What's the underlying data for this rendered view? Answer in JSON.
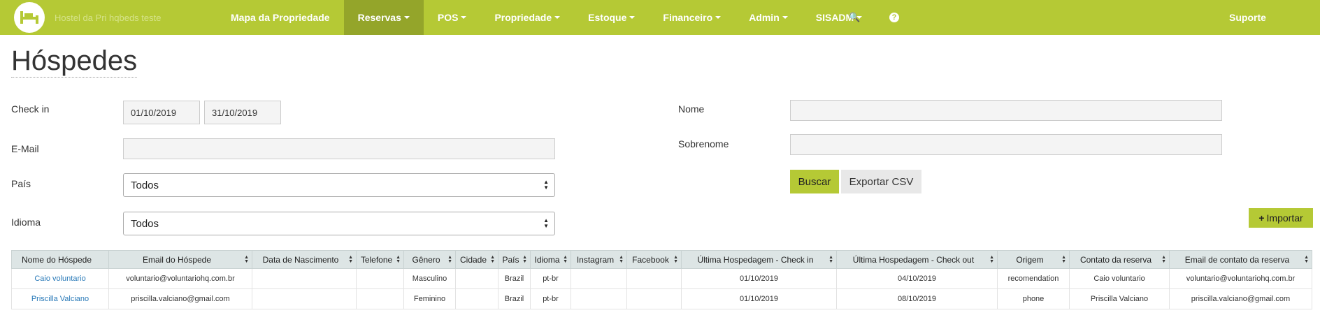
{
  "navbar": {
    "brand": "Hostel da Pri hqbeds teste",
    "items": [
      {
        "label": "Mapa da Propriedade",
        "caret": false
      },
      {
        "label": "Reservas",
        "caret": true
      },
      {
        "label": "POS",
        "caret": true
      },
      {
        "label": "Propriedade",
        "caret": true
      },
      {
        "label": "Estoque",
        "caret": true
      },
      {
        "label": "Financeiro",
        "caret": true
      },
      {
        "label": "Admin",
        "caret": true
      },
      {
        "label": "SISADM",
        "caret": true
      }
    ],
    "search_icon": "🔍",
    "help_icon": "?",
    "support": "Suporte"
  },
  "page": {
    "title": "Hóspedes"
  },
  "filters": {
    "checkin_label": "Check in",
    "checkin_from": "01/10/2019",
    "checkin_to": "31/10/2019",
    "email_label": "E-Mail",
    "email_value": "",
    "pais_label": "País",
    "pais_value": "Todos",
    "idioma_label": "Idioma",
    "idioma_value": "Todos",
    "nome_label": "Nome",
    "nome_value": "",
    "sobrenome_label": "Sobrenome",
    "sobrenome_value": ""
  },
  "buttons": {
    "buscar": "Buscar",
    "exportar": "Exportar CSV",
    "importar": "Importar",
    "importar_icon": "+"
  },
  "table": {
    "headers": [
      "Nome do Hóspede",
      "Email do Hóspede",
      "Data de Nascimento",
      "Telefone",
      "Gênero",
      "Cidade",
      "País",
      "Idioma",
      "Instagram",
      "Facebook",
      "Última Hospedagem - Check in",
      "Última Hospedagem - Check out",
      "Origem",
      "Contato da reserva",
      "Email de contato da reserva"
    ],
    "rows": [
      [
        "Caio voluntario",
        "voluntario@voluntariohq.com.br",
        "",
        "",
        "Masculino",
        "",
        "Brazil",
        "pt-br",
        "",
        "",
        "01/10/2019",
        "04/10/2019",
        "recomendation",
        "Caio voluntario",
        "voluntario@voluntariohq.com.br"
      ],
      [
        "Priscilla Valciano",
        "priscilla.valciano@gmail.com",
        "",
        "",
        "Feminino",
        "",
        "Brazil",
        "pt-br",
        "",
        "",
        "01/10/2019",
        "08/10/2019",
        "phone",
        "Priscilla Valciano",
        "priscilla.valciano@gmail.com"
      ]
    ]
  },
  "colors": {
    "navbar": "#b5c935",
    "navbar_active": "#94a52a",
    "link": "#2a7ab8"
  }
}
